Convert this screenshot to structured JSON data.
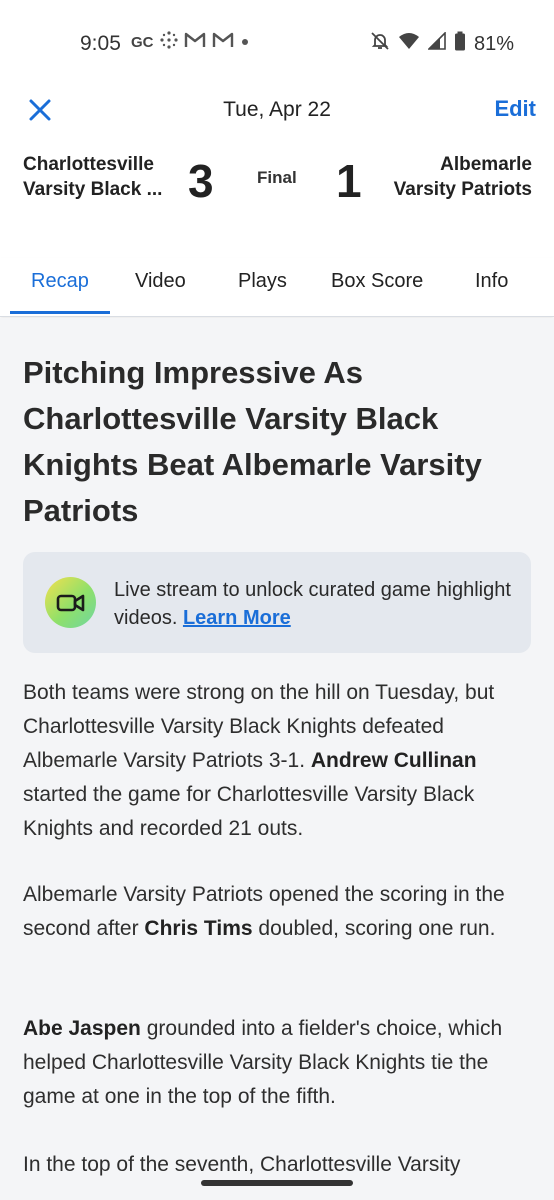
{
  "status_bar": {
    "time": "9:05",
    "left_icons": [
      "gc-icon",
      "dots-grid-icon",
      "gmail-icon",
      "gmail-icon",
      "dot-icon"
    ],
    "gc_text": "GC",
    "battery": "81%"
  },
  "header": {
    "date": "Tue, Apr 22",
    "edit_label": "Edit"
  },
  "scoreboard": {
    "home_team_line1": "Charlottesville",
    "home_team_line2": "Varsity Black ...",
    "home_score": "3",
    "status": "Final",
    "away_score": "1",
    "away_team_line1": "Albemarle",
    "away_team_line2": "Varsity Patriots"
  },
  "tabs": [
    {
      "label": "Recap",
      "active": true
    },
    {
      "label": "Video",
      "active": false
    },
    {
      "label": "Plays",
      "active": false
    },
    {
      "label": "Box Score",
      "active": false
    },
    {
      "label": "Info",
      "active": false
    }
  ],
  "article": {
    "headline": "Pitching Impressive As Charlottesville Varsity Black Knights Beat Albemarle Varsity Patriots",
    "promo_text": "Live stream to unlock curated game highlight videos.",
    "promo_link": "Learn More",
    "p1_a": "Both teams were strong on the hill on Tuesday, but Charlottesville Varsity Black Knights defeated Albemarle Varsity Patriots 3-1.",
    "p1_bold": "Andrew Cullinan",
    "p1_b": "started the game for Charlottesville Varsity Black Knights and recorded 21 outs.",
    "p2_a": "Albemarle Varsity Patriots opened the scoring in the second after",
    "p2_bold": "Chris Tims",
    "p2_b": "doubled, scoring one run.",
    "p3_bold": "Abe Jaspen",
    "p3_a": "grounded into a fielder's choice, which helped Charlottesville Varsity Black Knights tie the game at one in the top of the fifth.",
    "p4_partial": "In the top of the seventh, Charlottesville Varsity"
  },
  "colors": {
    "accent": "#1a6ed8",
    "content_bg": "#f4f5f7",
    "promo_bg": "#e4e8ee"
  }
}
